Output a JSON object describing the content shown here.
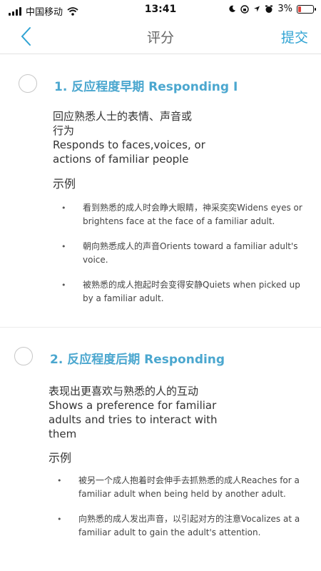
{
  "status": {
    "carrier": "中国移动",
    "time": "13:41",
    "battery": "3%"
  },
  "nav": {
    "title": "评分",
    "submit": "提交"
  },
  "sections": [
    {
      "title": "1. 反应程度早期 Responding I",
      "desc_line1": "回应熟悉人士的表情、声音或",
      "desc_line2": "行为",
      "desc_line3": "Responds to faces,voices, or",
      "desc_line4": "actions of familiar people",
      "example_label": "示例",
      "examples": [
        "看到熟悉的成人时会睁大眼睛，神采奕奕Widens eyes or brightens face at the face of a familiar adult.",
        "朝向熟悉成人的声音Orients toward a familiar adult's voice.",
        "被熟悉的成人抱起时会变得安静Quiets when picked up by a familiar adult."
      ]
    },
    {
      "title": "2. 反应程度后期 Responding",
      "desc_line1": "表现出更喜欢与熟悉的人的互动",
      "desc_line2": "Shows a preference for familiar",
      "desc_line3": "adults and tries to interact with",
      "desc_line4": "them",
      "example_label": "示例",
      "examples": [
        "被另一个成人抱着时会伸手去抓熟悉的成人Reaches for a familiar adult when being held by another adult.",
        "向熟悉的成人发出声音，以引起对方的注意Vocalizes at a familiar adult to gain the adult's attention."
      ]
    }
  ]
}
